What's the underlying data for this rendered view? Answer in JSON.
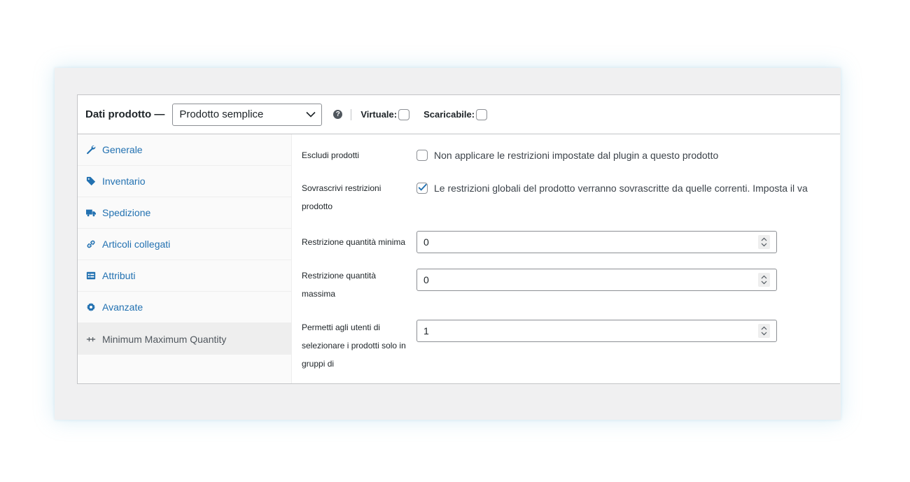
{
  "header": {
    "title": "Dati prodotto —",
    "product_type": "Prodotto semplice",
    "help_icon": "question-icon",
    "virtual_label": "Virtuale:",
    "virtual_checked": false,
    "downloadable_label": "Scaricabile:",
    "downloadable_checked": false
  },
  "tabs": [
    {
      "label": "Generale",
      "icon": "wrench-icon",
      "active": false
    },
    {
      "label": "Inventario",
      "icon": "tag-icon",
      "active": false
    },
    {
      "label": "Spedizione",
      "icon": "truck-icon",
      "active": false
    },
    {
      "label": "Articoli collegati",
      "icon": "link-icon",
      "active": false
    },
    {
      "label": "Attributi",
      "icon": "list-icon",
      "active": false
    },
    {
      "label": "Avanzate",
      "icon": "gear-icon",
      "active": false
    },
    {
      "label": "Minimum Maximum Quantity",
      "icon": "plugin-icon",
      "active": true
    }
  ],
  "fields": {
    "exclude": {
      "label": "Escludi prodotti",
      "checked": false,
      "description": "Non applicare le restrizioni impostate dal plugin a questo prodotto"
    },
    "override": {
      "label_line1": "Sovrascrivi restrizioni",
      "label_line2": "prodotto",
      "checked": true,
      "description": "Le restrizioni globali del prodotto verranno sovrascritte da quelle correnti. Imposta il va"
    },
    "min_qty": {
      "label": "Restrizione quantità minima",
      "value": "0"
    },
    "max_qty": {
      "label_line1": "Restrizione quantità",
      "label_line2": "massima",
      "value": "0"
    },
    "group_of": {
      "label_line1": "Permetti agli utenti di",
      "label_line2": "selezionare i prodotti solo in",
      "label_line3": "gruppi di",
      "value": "1"
    }
  },
  "colors": {
    "link": "#2271b1",
    "border": "#c3c4c7",
    "active_tab_bg": "#eeeeee"
  }
}
